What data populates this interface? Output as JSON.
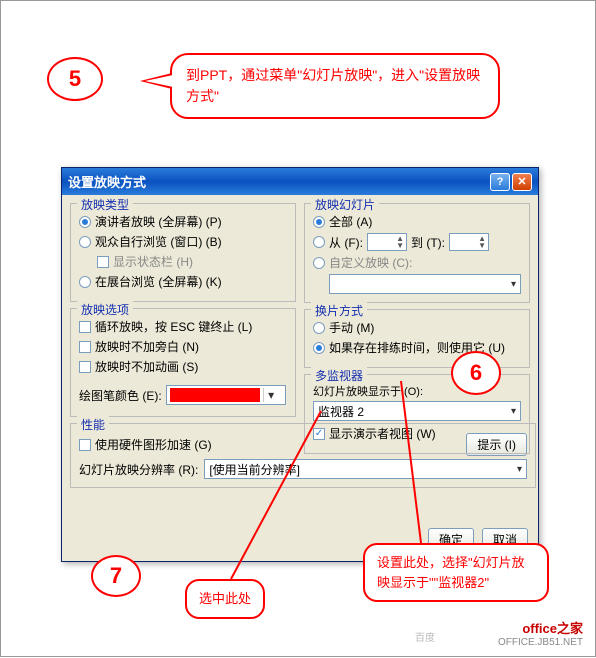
{
  "callouts": {
    "c5_num": "5",
    "c6_num": "6",
    "c7_num": "7",
    "s5_text": "到PPT，通过菜单\"幻灯片放映\"，进入\"设置放映方式\"",
    "a7_text": "选中此处",
    "a6_text": "设置此处，选择\"幻灯片放映显示于\"\"监视器2\""
  },
  "dialog": {
    "title": "设置放映方式",
    "group_type": {
      "title": "放映类型",
      "opt1": "演讲者放映 (全屏幕) (P)",
      "opt2": "观众自行浏览 (窗口) (B)",
      "opt2_sub": "显示状态栏 (H)",
      "opt3": "在展台浏览 (全屏幕) (K)"
    },
    "group_options": {
      "title": "放映选项",
      "opt1": "循环放映，按 ESC 键终止 (L)",
      "opt2": "放映时不加旁白 (N)",
      "opt3": "放映时不加动画 (S)",
      "pen_label": "绘图笔颜色 (E):"
    },
    "group_perf": {
      "title": "性能",
      "hw": "使用硬件图形加速 (G)",
      "res_label": "幻灯片放映分辨率 (R):",
      "res_value": "[使用当前分辨率]",
      "tips": "提示 (I)"
    },
    "group_slides": {
      "title": "放映幻灯片",
      "all": "全部 (A)",
      "from": "从 (F):",
      "to": "到 (T):",
      "custom": "自定义放映 (C):"
    },
    "group_advance": {
      "title": "换片方式",
      "manual": "手动 (M)",
      "timings": "如果存在排练时间，则使用它 (U)"
    },
    "group_monitor": {
      "title": "多监视器",
      "display_on": "幻灯片放映显示于 (O):",
      "monitor_value": "监视器 2",
      "presenter": "显示演示者视图 (W)"
    },
    "buttons": {
      "ok": "确定",
      "cancel": "取消"
    }
  },
  "watermark": {
    "main": "office之家",
    "sub": "OFFICE.JB51.NET"
  },
  "bd": "百度"
}
